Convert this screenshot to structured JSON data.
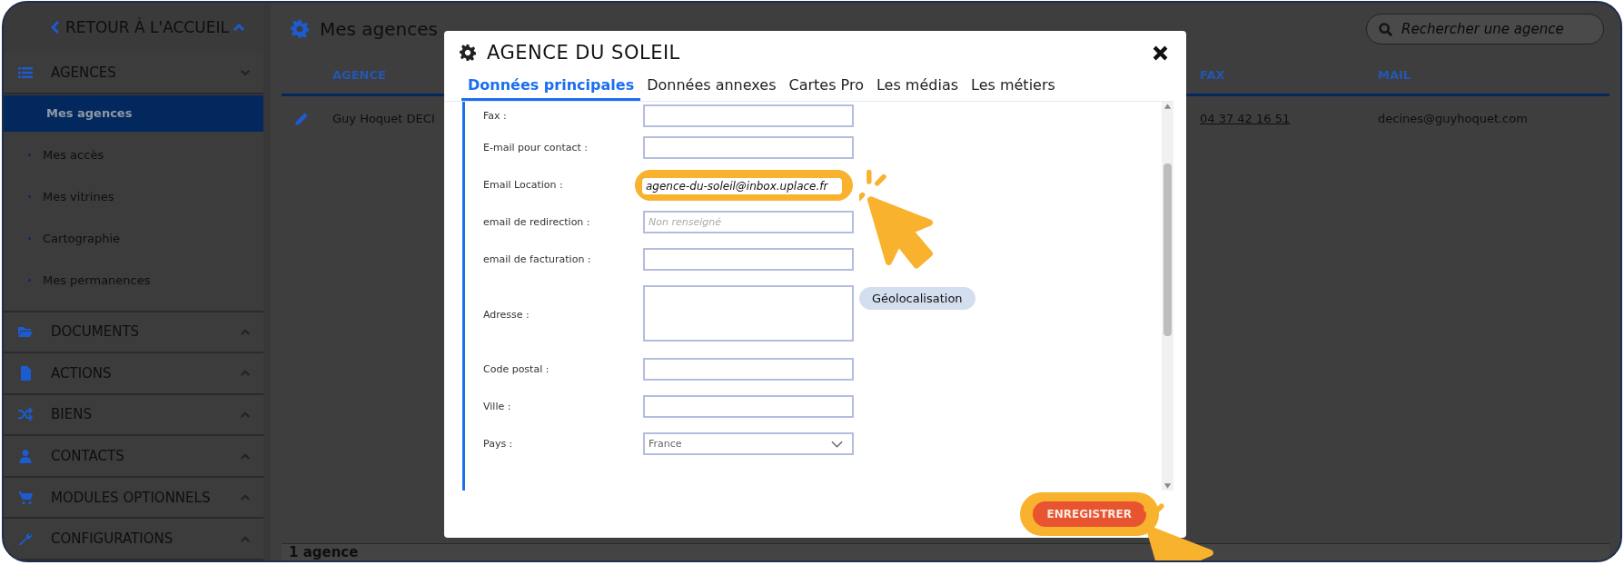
{
  "sidebar": {
    "back_link": "RETOUR À L'ACCUEIL",
    "sections": [
      {
        "label": "AGENCES",
        "expanded": true,
        "items": [
          {
            "label": "Mes agences",
            "selected": true
          },
          {
            "label": "Mes accès",
            "selected": false
          },
          {
            "label": "Mes vitrines",
            "selected": false
          },
          {
            "label": "Cartographie",
            "selected": false
          },
          {
            "label": "Mes permanences",
            "selected": false
          }
        ]
      },
      {
        "label": "DOCUMENTS",
        "expanded": false
      },
      {
        "label": "ACTIONS",
        "expanded": false
      },
      {
        "label": "BIENS",
        "expanded": false
      },
      {
        "label": "CONTACTS",
        "expanded": false
      },
      {
        "label": "MODULES OPTIONNELS",
        "expanded": false
      },
      {
        "label": "CONFIGURATIONS",
        "expanded": false
      }
    ]
  },
  "page": {
    "title": "Mes agences",
    "search": {
      "placeholder": "Rechercher une agence"
    }
  },
  "table": {
    "columns": [
      "AGENCE",
      "FAX",
      "MAIL"
    ],
    "rows": [
      {
        "agence": "Guy Hoquet DECI",
        "fax": "04 37 42 16 51",
        "mail": "decines@guyhoquet.com"
      }
    ]
  },
  "status_bar": {
    "count": "1 agence"
  },
  "modal": {
    "title": "AGENCE DU SOLEIL",
    "tabs": [
      {
        "label": "Données principales",
        "selected": true
      },
      {
        "label": "Données annexes",
        "selected": false
      },
      {
        "label": "Cartes Pro",
        "selected": false
      },
      {
        "label": "Les médias",
        "selected": false
      },
      {
        "label": "Les métiers",
        "selected": false
      }
    ],
    "fields": [
      {
        "kind": "text",
        "label": "Fax :",
        "highlighted": false
      },
      {
        "kind": "text",
        "label": "E-mail pour contact :",
        "highlighted": false
      },
      {
        "kind": "text",
        "label": "Email Location :",
        "value": "agence-du-soleil@inbox.uplace.fr",
        "highlighted": true
      },
      {
        "kind": "text",
        "label": "email de redirection :",
        "placeholder": "Non renseigné",
        "highlighted": false
      },
      {
        "kind": "text",
        "label": "email de facturation :",
        "highlighted": false
      },
      {
        "kind": "textarea",
        "label": "Adresse :",
        "button": "Géolocalisation",
        "highlighted": false
      },
      {
        "kind": "text",
        "label": "Code postal :",
        "highlighted": false
      },
      {
        "kind": "text",
        "label": "Ville :",
        "highlighted": false
      },
      {
        "kind": "select",
        "label": "Pays :",
        "value": "France",
        "highlighted": false
      }
    ],
    "save_button": {
      "label": "ENREGISTRER",
      "highlighted": true
    }
  }
}
